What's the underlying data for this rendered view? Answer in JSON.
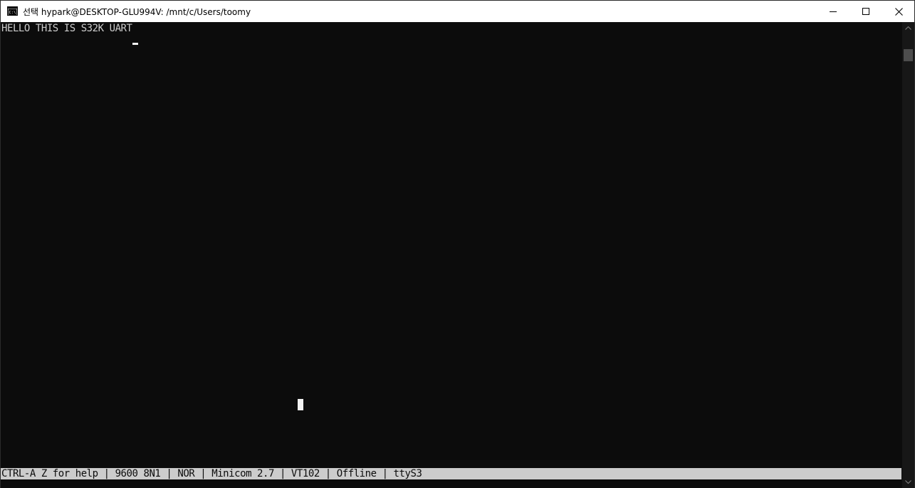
{
  "window": {
    "title": "선택 hypark@DESKTOP-GLU994V: /mnt/c/Users/toomy",
    "icons": {
      "app": "console-icon",
      "minimize": "minimize-icon",
      "maximize": "maximize-icon",
      "close": "close-icon"
    }
  },
  "terminal": {
    "lines": [
      "HELLO THIS IS S32K UART"
    ],
    "status_bar": "CTRL-A Z for help | 9600 8N1 | NOR | Minicom 2.7 | VT102 | Offline | ttyS3"
  },
  "scrollbar": {
    "up_icon": "arrow-up-icon",
    "down_icon": "arrow-down-icon"
  },
  "colors": {
    "background": "#0c0c0c",
    "foreground": "#cccccc",
    "status_bar_bg": "#cccccc",
    "titlebar_bg": "#ffffff"
  }
}
